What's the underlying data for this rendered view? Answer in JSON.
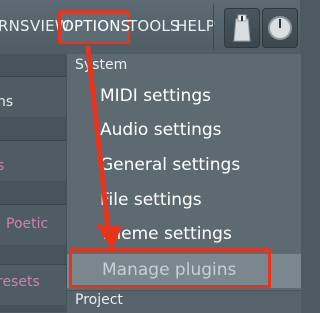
{
  "menubar": {
    "items": [
      "RNS",
      "VIEW",
      "OPTIONS",
      "TOOLS",
      "HELP"
    ]
  },
  "left_panel": {
    "labels": [
      "ns",
      "s",
      "Poetic",
      "resets"
    ]
  },
  "dropdown": {
    "section_system": "System",
    "items": [
      "MIDI settings",
      "Audio settings",
      "General settings",
      "File settings",
      "Theme settings",
      "Manage plugins"
    ],
    "section_project": "Project"
  },
  "annotation": {
    "color": "#e8341c"
  },
  "icons": {
    "knob": "knob-icon",
    "dial": "dial-icon"
  }
}
